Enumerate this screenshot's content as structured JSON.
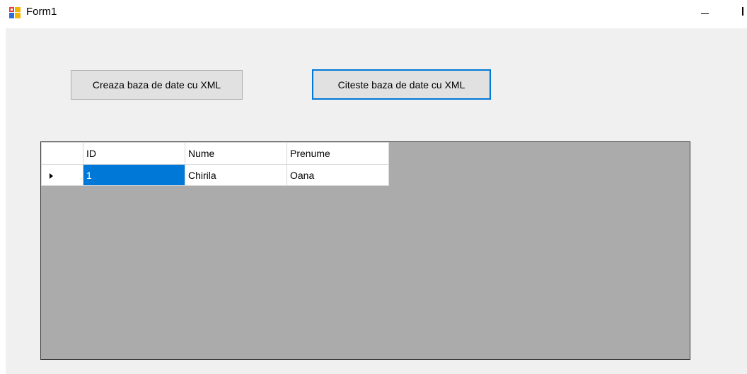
{
  "window": {
    "title": "Form1"
  },
  "buttons": {
    "create_label": "Creaza baza de date cu XML",
    "read_label": "Citeste baza de date cu XML"
  },
  "grid": {
    "columns": [
      "ID",
      "Nume",
      "Prenume"
    ],
    "rows": [
      {
        "id": "1",
        "nume": "Chirila",
        "prenume": "Oana"
      }
    ],
    "current_row_icon": "current-row-arrow-icon",
    "selection_color": "#0078d7",
    "background_color": "#ababab"
  },
  "colors": {
    "focus_border": "#0078d7",
    "form_background": "#f0f0f0"
  }
}
